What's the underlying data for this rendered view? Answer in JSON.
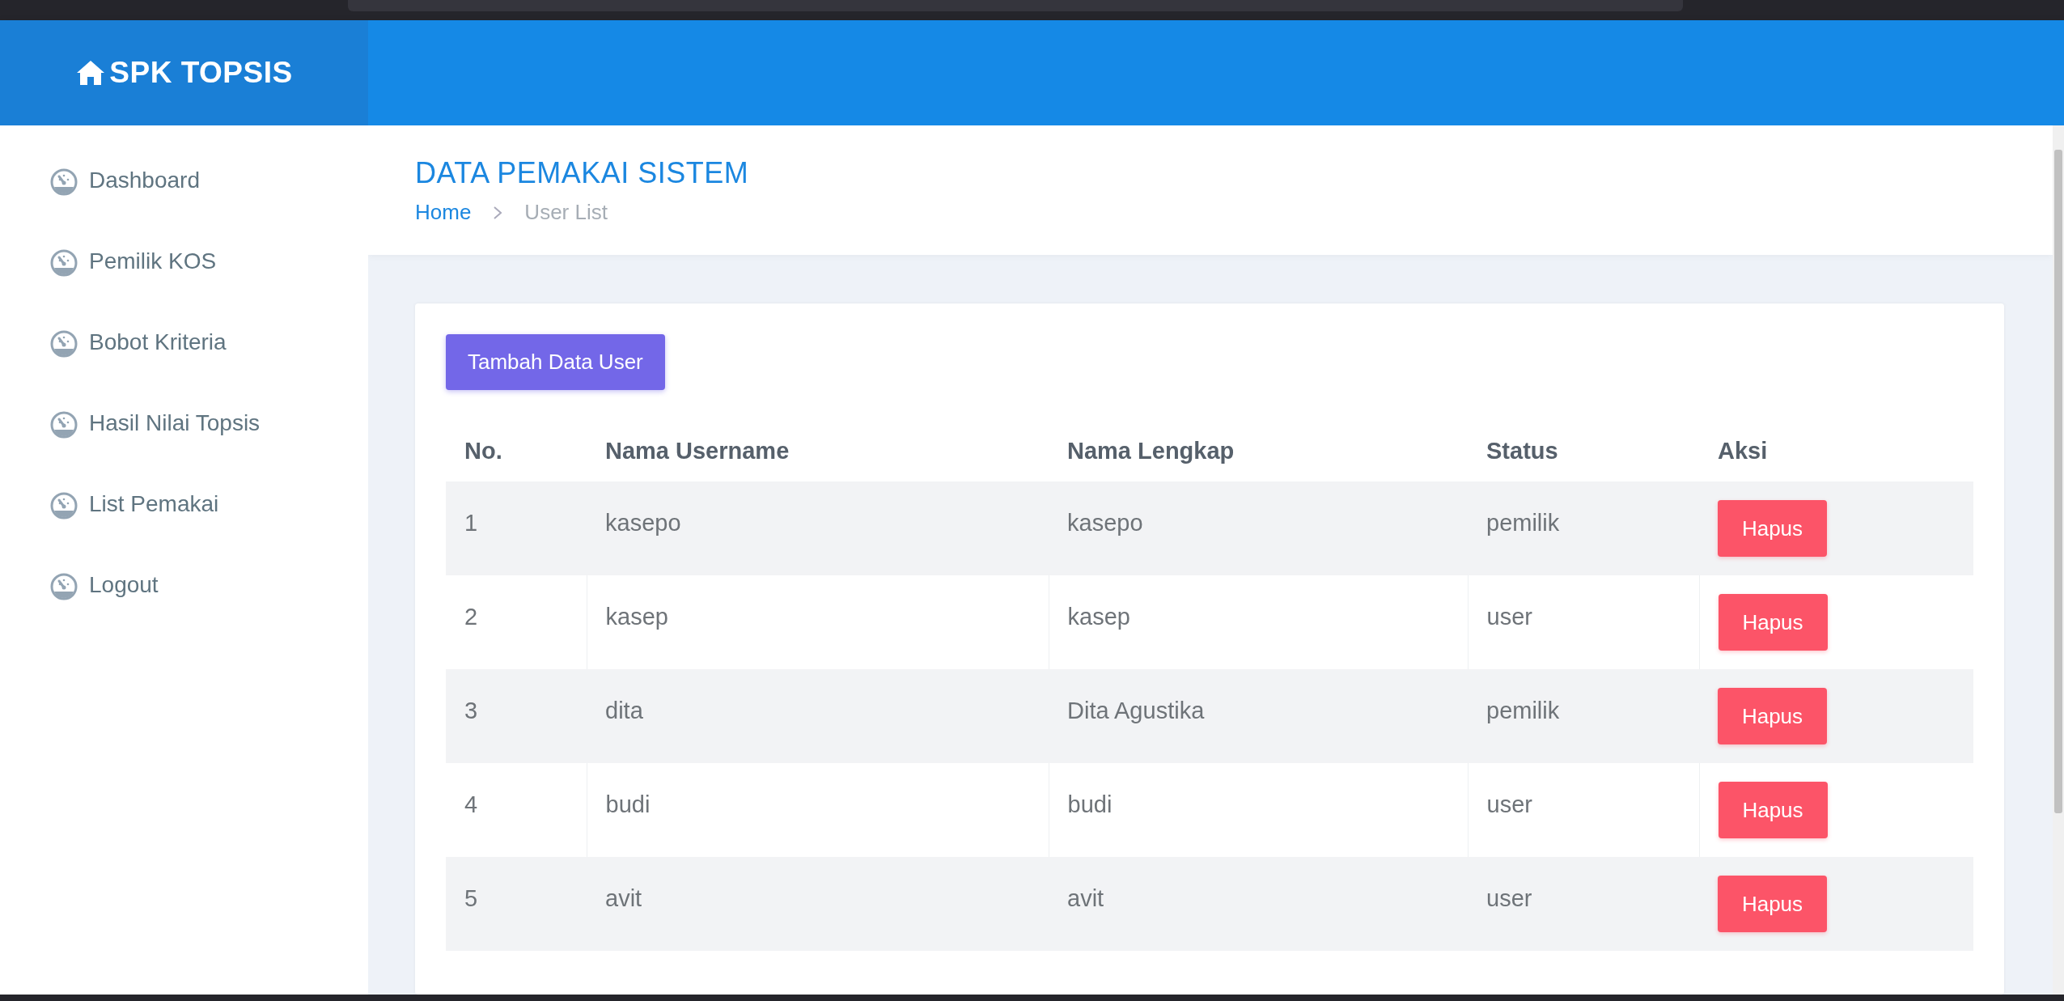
{
  "brand": {
    "title": "SPK TOPSIS"
  },
  "sidebar": {
    "items": [
      {
        "label": "Dashboard"
      },
      {
        "label": "Pemilik KOS"
      },
      {
        "label": "Bobot Kriteria"
      },
      {
        "label": "Hasil Nilai Topsis"
      },
      {
        "label": "List Pemakai"
      },
      {
        "label": "Logout"
      }
    ]
  },
  "page_header": {
    "title": "DATA PEMAKAI SISTEM",
    "breadcrumb": [
      "Home",
      "User List"
    ]
  },
  "add_button": "Tambah Data User",
  "table": {
    "columns": [
      "No.",
      "Nama Username",
      "Nama Lengkap",
      "Status",
      "Aksi"
    ],
    "rows": [
      {
        "no": "1",
        "username": "kasepo",
        "full_name": "kasepo",
        "status": "pemilik",
        "action": "Hapus"
      },
      {
        "no": "2",
        "username": "kasep",
        "full_name": "kasep",
        "status": "user",
        "action": "Hapus"
      },
      {
        "no": "3",
        "username": "dita",
        "full_name": "Dita Agustika",
        "status": "pemilik",
        "action": "Hapus"
      },
      {
        "no": "4",
        "username": "budi",
        "full_name": "budi",
        "status": "user",
        "action": "Hapus"
      },
      {
        "no": "5",
        "username": "avit",
        "full_name": "avit",
        "status": "user",
        "action": "Hapus"
      }
    ]
  }
}
